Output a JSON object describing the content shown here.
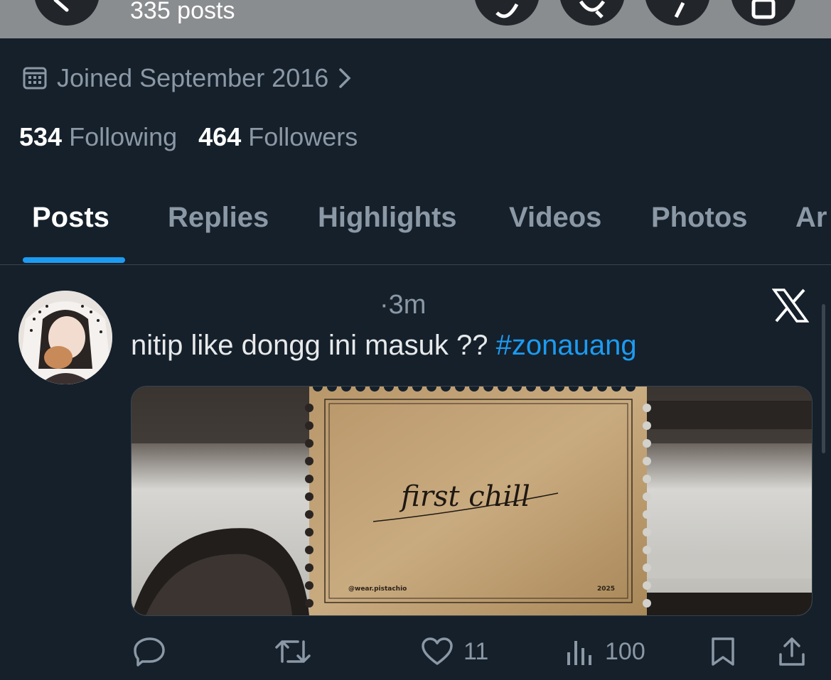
{
  "header": {
    "posts_count": "335 posts"
  },
  "profile": {
    "joined": "Joined September 2016",
    "following_count": "534",
    "following_label": "Following",
    "followers_count": "464",
    "followers_label": "Followers"
  },
  "tabs": [
    {
      "label": "Posts",
      "active": true
    },
    {
      "label": "Replies"
    },
    {
      "label": "Highlights"
    },
    {
      "label": "Videos"
    },
    {
      "label": "Photos"
    },
    {
      "label": "Ar"
    }
  ],
  "tweet": {
    "time": "·3m",
    "text": "nitip like dongg ini masuk ?? ",
    "hashtag": "#zonauang",
    "media": {
      "title": "first chill",
      "handle": "@wear.pistachio",
      "year": "2025"
    },
    "actions": {
      "likes": "11",
      "views": "100"
    }
  },
  "colors": {
    "background": "#15202b",
    "accent": "#1d9bf0",
    "muted_text": "#8b98a5",
    "topbar": "#8a8d90"
  }
}
